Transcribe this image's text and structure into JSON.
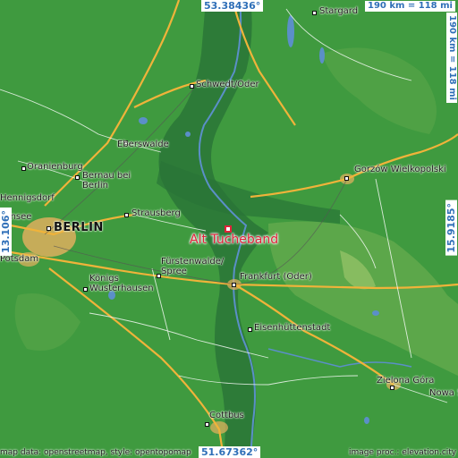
{
  "map": {
    "colors": {
      "terrain": "#3f9a3f",
      "lowland": "#2f7d3f",
      "highland": "#7ab35a",
      "water": "#5b8fc8",
      "road_major": "#f0b33a",
      "road_minor": "#ffffff",
      "urban": "#e8b060",
      "target": "#e0223a",
      "coord_text": "#2f6fb8"
    },
    "coords": {
      "north": "53.38436°",
      "south": "51.67362°",
      "west": "13.106°",
      "east": "15.9185°"
    },
    "scale": {
      "horizontal": "190 km = 118 mi",
      "vertical": "190 km = 118 mi"
    },
    "target": {
      "name": "Alt Tucheband"
    },
    "places": {
      "stargard": "Stargard",
      "schwedt": "Schwedt/Oder",
      "eberswalde": "Eberswalde",
      "oranienburg": "Oranienburg",
      "bernau": "Bernau bei\nBerlin",
      "hennigsdorf": "Hennigsdorf",
      "kensee": "kensee",
      "berlin": "BERLIN",
      "strausberg": "Strausberg",
      "potsdam": "Potsdam",
      "gorzow": "Gorzów Wielkopolski",
      "furstenwalde": "Fürstenwalde/\nSpree",
      "frankfurt": "Frankfurt (Oder)",
      "konigs": "Königs\nWusterhausen",
      "eisenhuttenstadt": "Eisenhüttenstadt",
      "zielona": "Zielona Góra",
      "nowa": "Nowa S",
      "cottbus": "Cottbus"
    },
    "credits": {
      "left": "map data: openstreetmap, style: opentopomap",
      "right": "image proc.: elevation.city"
    }
  }
}
